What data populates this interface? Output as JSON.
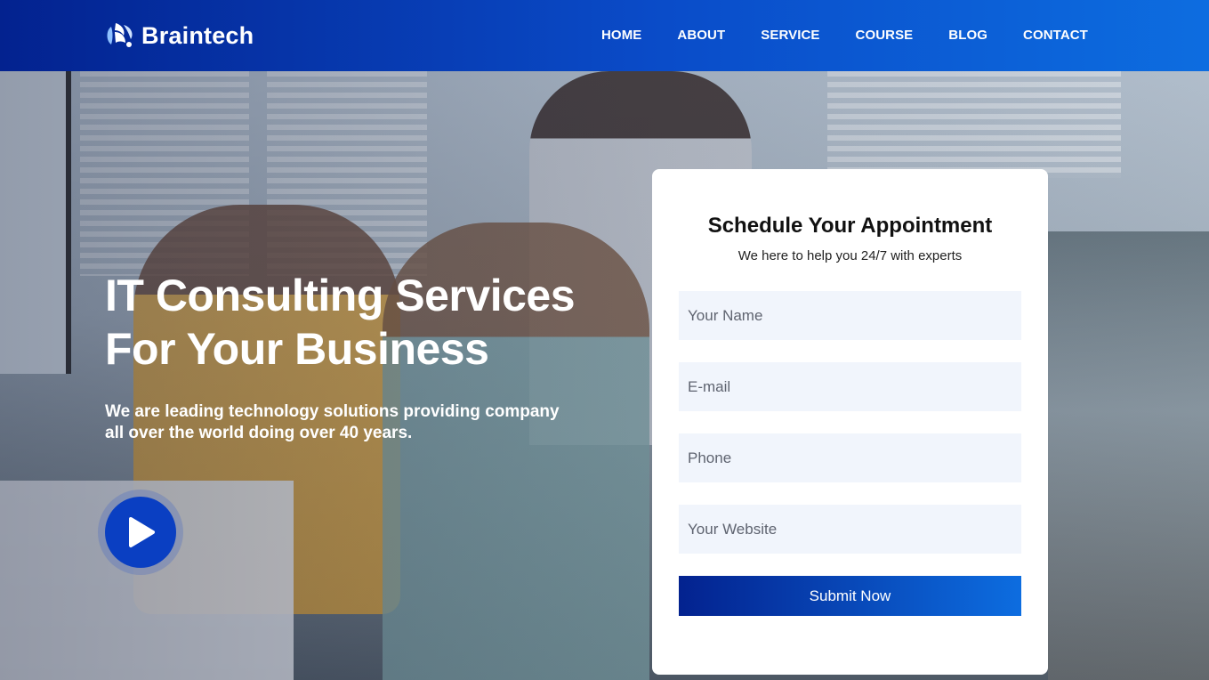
{
  "brand": {
    "name": "Braintech"
  },
  "nav": {
    "items": [
      {
        "label": "HOME"
      },
      {
        "label": "ABOUT"
      },
      {
        "label": "SERVICE"
      },
      {
        "label": "COURSE"
      },
      {
        "label": "BLOG"
      },
      {
        "label": "CONTACT"
      }
    ]
  },
  "hero": {
    "title_line1": "IT Consulting Services",
    "title_line2": "For Your Business",
    "subtitle_line1": "We are leading technology solutions providing company",
    "subtitle_line2": "all over the world doing over 40 years.",
    "play_icon": "play-icon"
  },
  "form": {
    "title": "Schedule Your Appointment",
    "subtitle": "We here to help you 24/7 with experts",
    "name_placeholder": "Your Name",
    "email_placeholder": "E-mail",
    "phone_placeholder": "Phone",
    "website_placeholder": "Your Website",
    "submit_label": "Submit Now"
  },
  "colors": {
    "header_gradient_start": "#03228f",
    "header_gradient_end": "#0d6de0",
    "field_bg": "#f1f5fc",
    "play_button": "#0a3fc2"
  }
}
